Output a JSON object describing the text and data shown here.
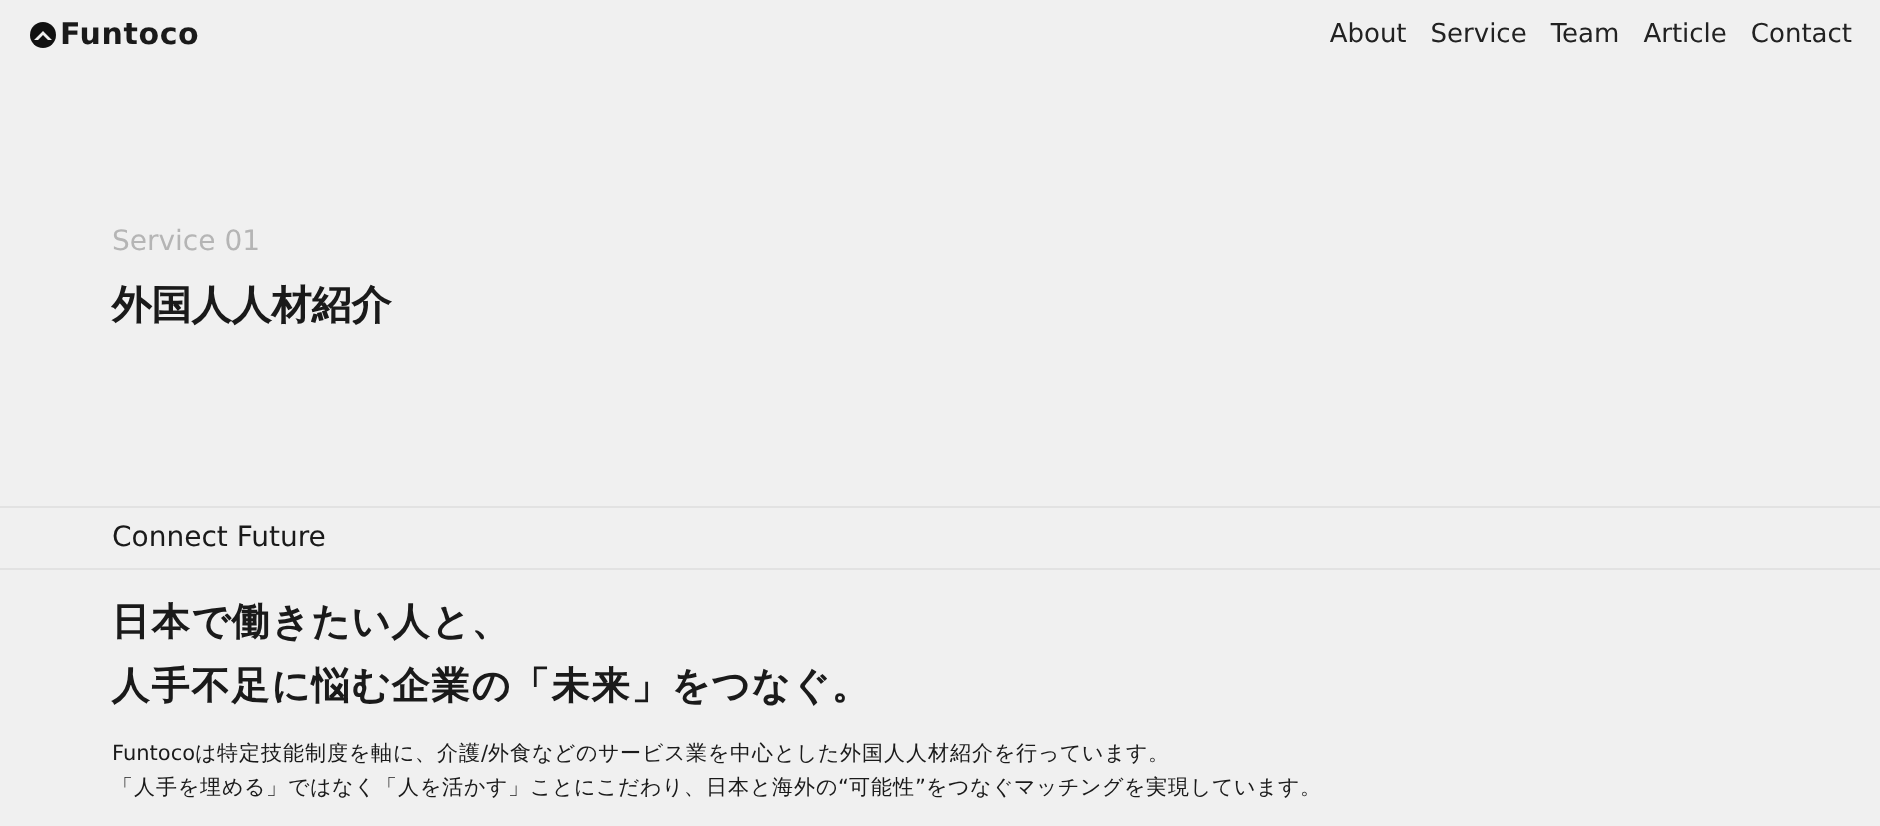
{
  "header": {
    "logo": "Funtoco",
    "nav": [
      {
        "label": "About"
      },
      {
        "label": "Service"
      },
      {
        "label": "Team"
      },
      {
        "label": "Article"
      },
      {
        "label": "Contact"
      }
    ]
  },
  "hero": {
    "eyebrow": "Service 01",
    "title": "外国人人材紹介"
  },
  "section": {
    "label": "Connect Future",
    "headline": [
      "日本で働きたい人と、",
      "人手不足に悩む企業の「未来」をつなぐ。"
    ],
    "body": [
      "Funtocoは特定技能制度を軸に、介護/外食などのサービス業を中心とした外国人人材紹介を行っています。",
      "「人手を埋める」ではなく「人を活かす」ことにこだわり、日本と海外の“可能性”をつなぐマッチングを実現しています。"
    ]
  }
}
